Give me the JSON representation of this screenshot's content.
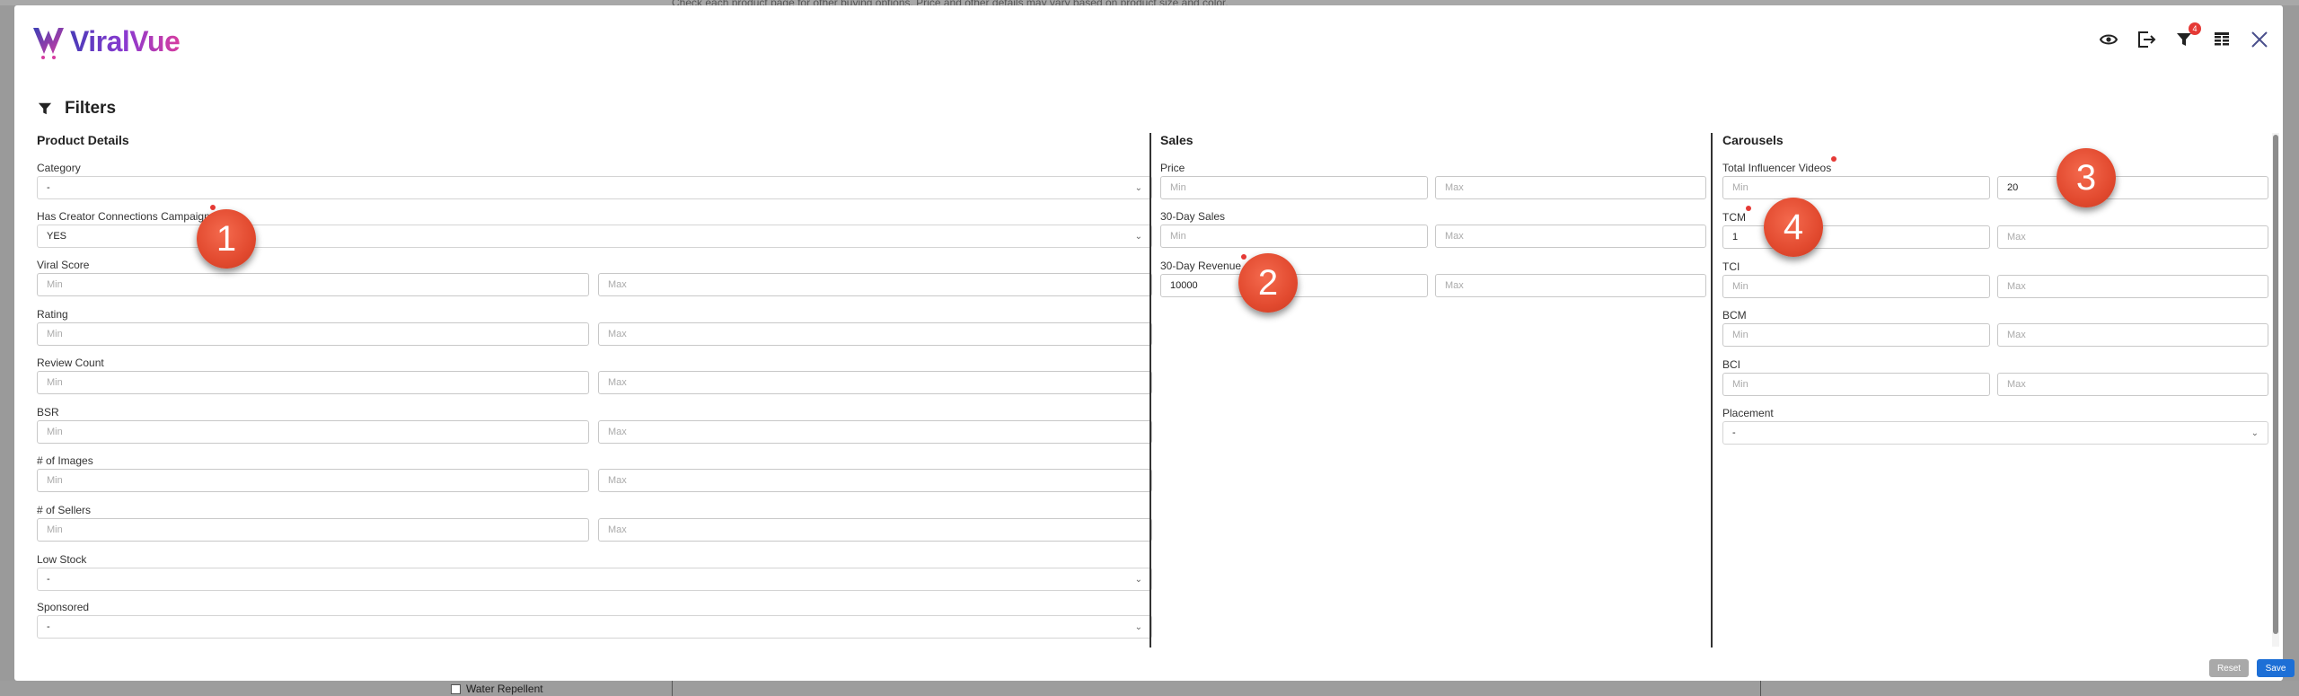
{
  "backdrop": {
    "top_text": "Check each product page for other buying options. Price and other details may vary based on product size and color.",
    "bottom_checkbox_label": "Water Repellent"
  },
  "app": {
    "name": "ViralVue"
  },
  "toolbar": {
    "filter_badge_count": "4"
  },
  "filters": {
    "title": "Filters"
  },
  "placeholders": {
    "min": "Min",
    "max": "Max",
    "select": "-"
  },
  "product_details": {
    "heading": "Product Details",
    "category": {
      "label": "Category",
      "value": "-"
    },
    "has_creator_connections": {
      "label": "Has Creator Connections Campaign",
      "value": "YES"
    },
    "viral_score": {
      "label": "Viral Score"
    },
    "rating": {
      "label": "Rating"
    },
    "review_count": {
      "label": "Review Count"
    },
    "bsr": {
      "label": "BSR"
    },
    "num_images": {
      "label": "# of Images"
    },
    "num_sellers": {
      "label": "# of Sellers"
    },
    "low_stock": {
      "label": "Low Stock",
      "value": "-"
    },
    "sponsored": {
      "label": "Sponsored",
      "value": "-"
    }
  },
  "sales": {
    "heading": "Sales",
    "price": {
      "label": "Price"
    },
    "sales_30": {
      "label": "30-Day Sales"
    },
    "revenue_30": {
      "label": "30-Day Revenue",
      "min_value": "10000"
    }
  },
  "carousels": {
    "heading": "Carousels",
    "total_influencer_videos": {
      "label": "Total Influencer Videos",
      "max_value": "20"
    },
    "tcm": {
      "label": "TCM",
      "min_value": "1"
    },
    "tci": {
      "label": "TCI"
    },
    "bcm": {
      "label": "BCM"
    },
    "bci": {
      "label": "BCI"
    },
    "placement": {
      "label": "Placement",
      "value": "-"
    }
  },
  "callouts": [
    "1",
    "2",
    "3",
    "4"
  ],
  "buttons": {
    "reset": "Reset",
    "save": "Save"
  },
  "colors": {
    "accent": "#1d6fd6",
    "indicator": "#e53935",
    "callout": "#e24a2f"
  }
}
